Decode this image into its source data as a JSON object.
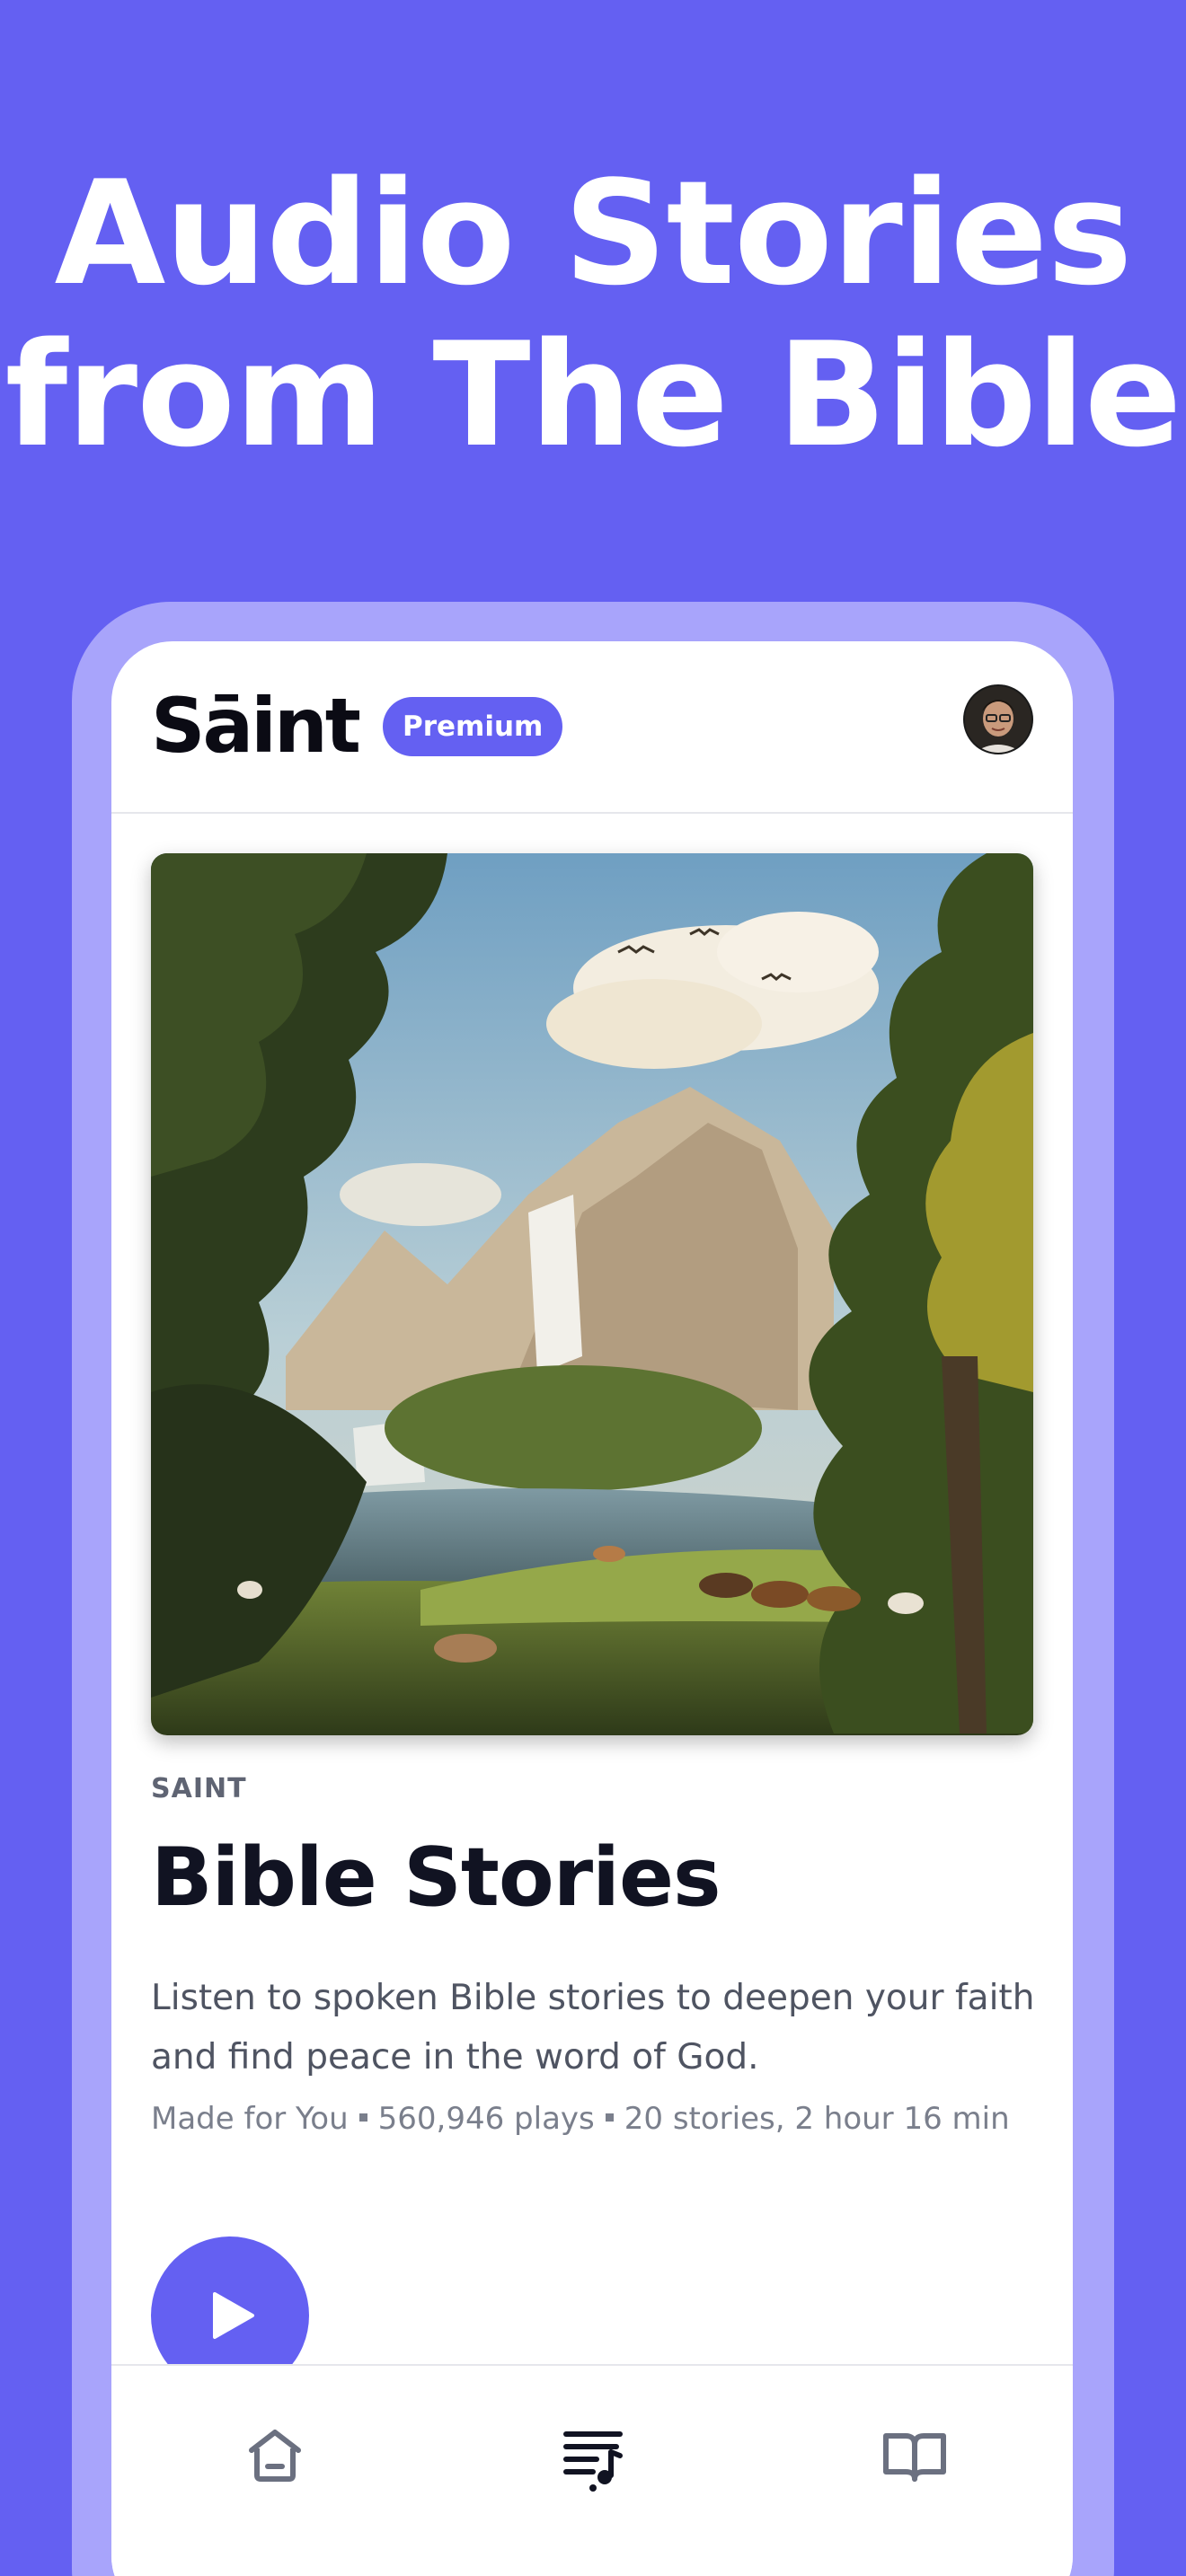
{
  "headline": {
    "line1": "Audio Stories",
    "line2": "from The Bible"
  },
  "app": {
    "logo": "Sāint",
    "badge": "Premium"
  },
  "collection": {
    "label": "SAINT",
    "title": "Bible Stories",
    "description": "Listen to spoken Bible stories to deepen your faith and find peace in the word of God.",
    "meta": {
      "made_for": "Made for You",
      "plays": "560,946 plays",
      "length": "20 stories, 2 hour 16 min"
    }
  },
  "nav": {
    "items": [
      {
        "icon": "home-icon"
      },
      {
        "icon": "playlist-icon"
      },
      {
        "icon": "bible-book-icon"
      }
    ]
  },
  "colors": {
    "background": "#6460f2",
    "accent": "#6460f2",
    "frame": "#a8a4fb"
  }
}
